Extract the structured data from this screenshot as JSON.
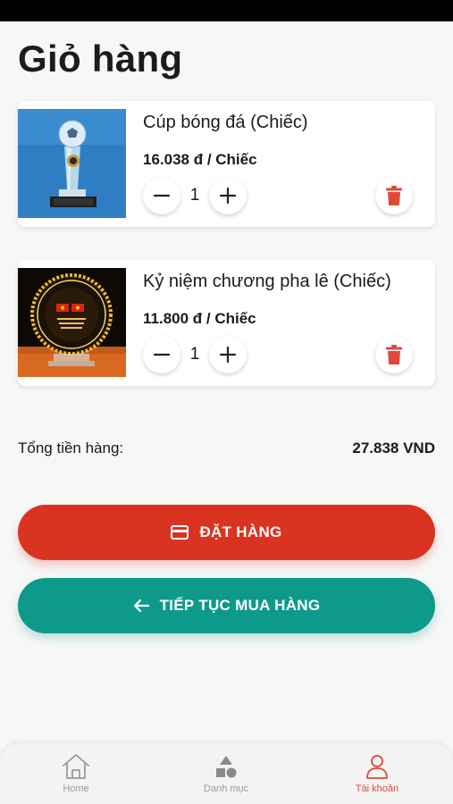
{
  "page": {
    "title": "Giỏ hàng"
  },
  "cart": {
    "items": [
      {
        "name": "Cúp bóng đá (Chiếc)",
        "price": "16.038 đ / Chiếc",
        "quantity": "1",
        "thumbnail_icon": "trophy-image"
      },
      {
        "name": "Kỷ niệm chương pha lê (Chiếc)",
        "price": "11.800 đ / Chiếc",
        "quantity": "1",
        "thumbnail_icon": "crystal-plaque-image"
      }
    ]
  },
  "summary": {
    "label": "Tổng tiền hàng:",
    "value": "27.838 VND"
  },
  "actions": {
    "order_label": "ĐẶT HÀNG",
    "continue_label": "TIẾP TỤC MUA HÀNG"
  },
  "nav": {
    "items": [
      {
        "label": "Home",
        "icon": "home-icon"
      },
      {
        "label": "Danh mục",
        "icon": "category-icon"
      },
      {
        "label": "Tài khoản",
        "icon": "account-icon",
        "active": true
      }
    ]
  },
  "colors": {
    "accent_red": "#db3322",
    "accent_teal": "#0e9a8a",
    "delete_red": "#e0493a",
    "background": "#f7f7f7"
  }
}
